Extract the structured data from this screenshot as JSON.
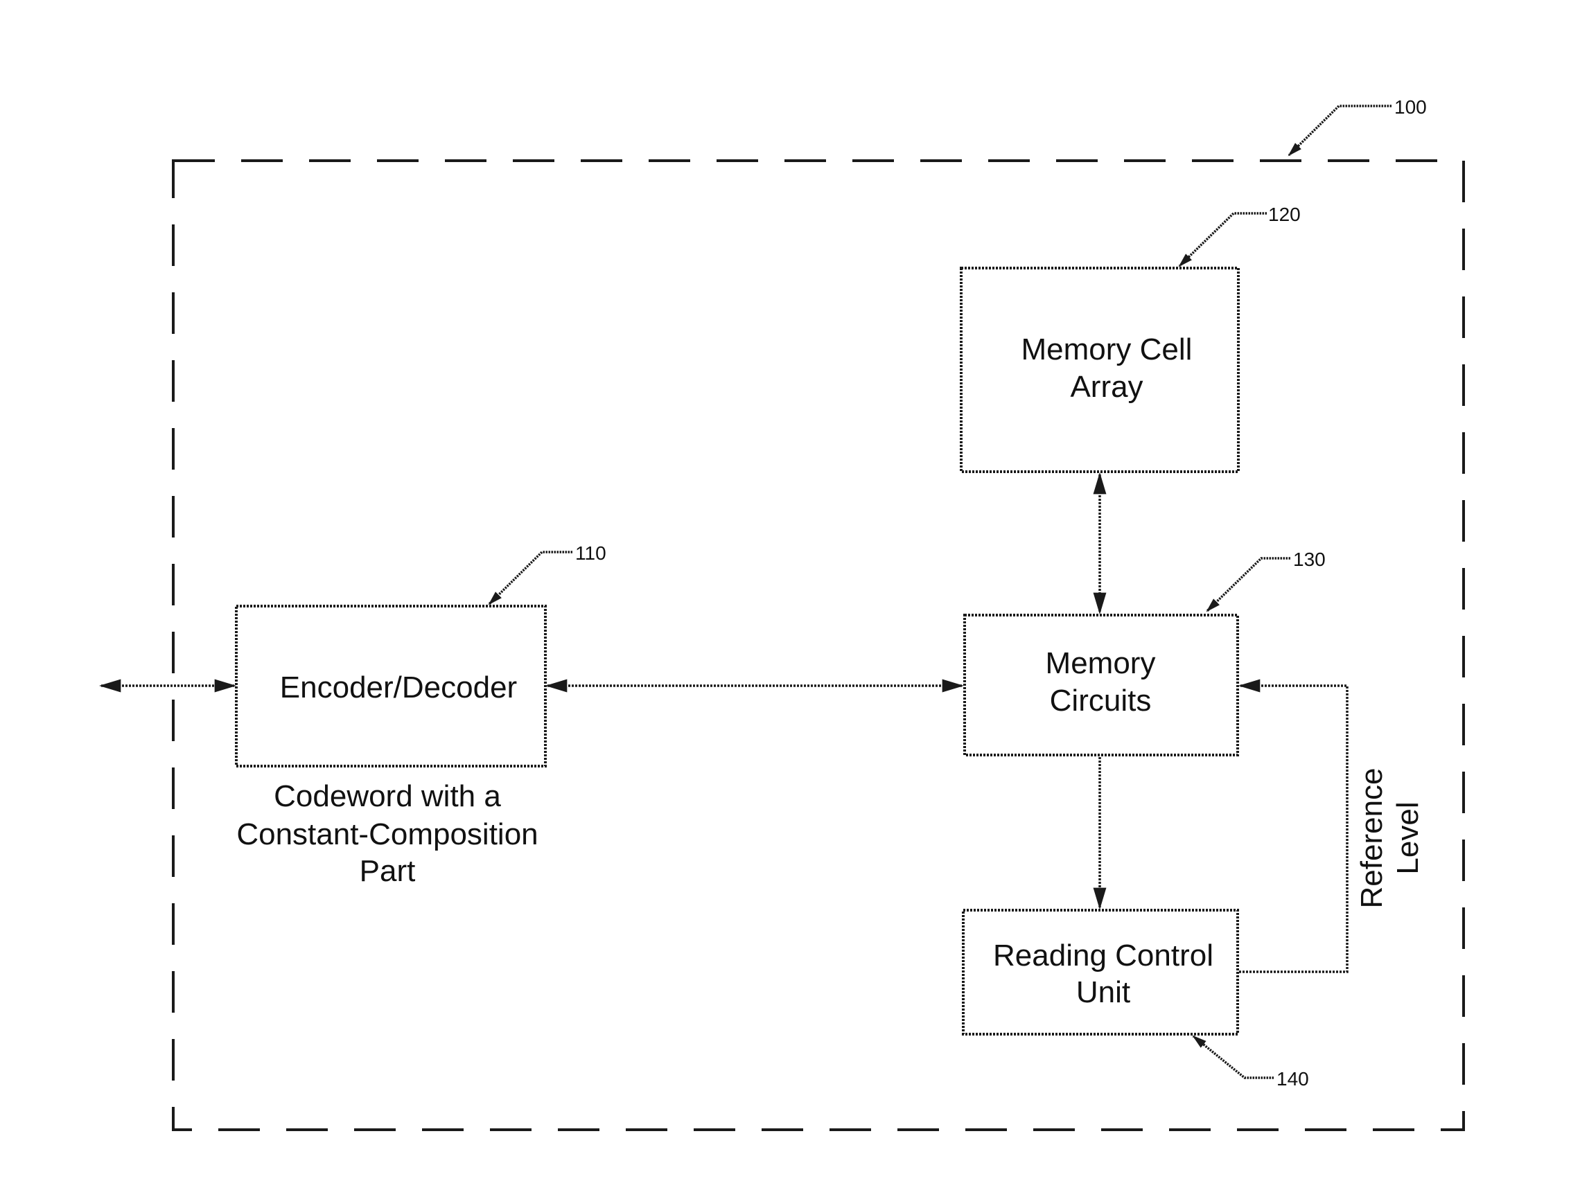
{
  "figure": {
    "system_ref": "100",
    "blocks": {
      "encoder": {
        "ref": "110",
        "lines": [
          "Encoder/Decoder"
        ]
      },
      "memory_cell_array": {
        "ref": "120",
        "lines": [
          "Memory Cell",
          "Array"
        ]
      },
      "memory_circuits": {
        "ref": "130",
        "lines": [
          "Memory",
          "Circuits"
        ]
      },
      "reading_control": {
        "ref": "140",
        "lines": [
          "Reading Control",
          "Unit"
        ]
      }
    },
    "annotations": {
      "codeword": [
        "Codeword with a",
        "Constant-Composition",
        "Part"
      ],
      "reference_level": [
        "Reference",
        "Level"
      ]
    },
    "connections": [
      {
        "from": "external",
        "to": "encoder",
        "direction": "bidirectional"
      },
      {
        "from": "encoder",
        "to": "memory_circuits",
        "direction": "bidirectional"
      },
      {
        "from": "memory_cell_array",
        "to": "memory_circuits",
        "direction": "bidirectional"
      },
      {
        "from": "memory_circuits",
        "to": "reading_control",
        "direction": "forward"
      },
      {
        "from": "reading_control",
        "to": "memory_circuits",
        "direction": "forward",
        "label": "Reference Level"
      }
    ]
  }
}
